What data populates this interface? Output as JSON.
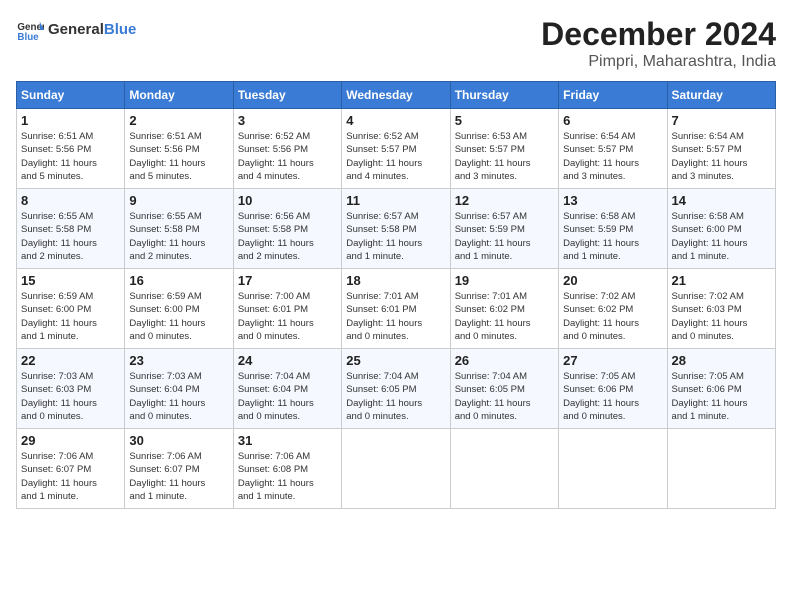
{
  "logo": {
    "general": "General",
    "blue": "Blue"
  },
  "title": "December 2024",
  "subtitle": "Pimpri, Maharashtra, India",
  "days_header": [
    "Sunday",
    "Monday",
    "Tuesday",
    "Wednesday",
    "Thursday",
    "Friday",
    "Saturday"
  ],
  "weeks": [
    [
      {
        "day": "1",
        "sunrise": "6:51 AM",
        "sunset": "5:56 PM",
        "daylight": "11 hours and 5 minutes."
      },
      {
        "day": "2",
        "sunrise": "6:51 AM",
        "sunset": "5:56 PM",
        "daylight": "11 hours and 5 minutes."
      },
      {
        "day": "3",
        "sunrise": "6:52 AM",
        "sunset": "5:56 PM",
        "daylight": "11 hours and 4 minutes."
      },
      {
        "day": "4",
        "sunrise": "6:52 AM",
        "sunset": "5:57 PM",
        "daylight": "11 hours and 4 minutes."
      },
      {
        "day": "5",
        "sunrise": "6:53 AM",
        "sunset": "5:57 PM",
        "daylight": "11 hours and 3 minutes."
      },
      {
        "day": "6",
        "sunrise": "6:54 AM",
        "sunset": "5:57 PM",
        "daylight": "11 hours and 3 minutes."
      },
      {
        "day": "7",
        "sunrise": "6:54 AM",
        "sunset": "5:57 PM",
        "daylight": "11 hours and 3 minutes."
      }
    ],
    [
      {
        "day": "8",
        "sunrise": "6:55 AM",
        "sunset": "5:58 PM",
        "daylight": "11 hours and 2 minutes."
      },
      {
        "day": "9",
        "sunrise": "6:55 AM",
        "sunset": "5:58 PM",
        "daylight": "11 hours and 2 minutes."
      },
      {
        "day": "10",
        "sunrise": "6:56 AM",
        "sunset": "5:58 PM",
        "daylight": "11 hours and 2 minutes."
      },
      {
        "day": "11",
        "sunrise": "6:57 AM",
        "sunset": "5:58 PM",
        "daylight": "11 hours and 1 minute."
      },
      {
        "day": "12",
        "sunrise": "6:57 AM",
        "sunset": "5:59 PM",
        "daylight": "11 hours and 1 minute."
      },
      {
        "day": "13",
        "sunrise": "6:58 AM",
        "sunset": "5:59 PM",
        "daylight": "11 hours and 1 minute."
      },
      {
        "day": "14",
        "sunrise": "6:58 AM",
        "sunset": "6:00 PM",
        "daylight": "11 hours and 1 minute."
      }
    ],
    [
      {
        "day": "15",
        "sunrise": "6:59 AM",
        "sunset": "6:00 PM",
        "daylight": "11 hours and 1 minute."
      },
      {
        "day": "16",
        "sunrise": "6:59 AM",
        "sunset": "6:00 PM",
        "daylight": "11 hours and 0 minutes."
      },
      {
        "day": "17",
        "sunrise": "7:00 AM",
        "sunset": "6:01 PM",
        "daylight": "11 hours and 0 minutes."
      },
      {
        "day": "18",
        "sunrise": "7:01 AM",
        "sunset": "6:01 PM",
        "daylight": "11 hours and 0 minutes."
      },
      {
        "day": "19",
        "sunrise": "7:01 AM",
        "sunset": "6:02 PM",
        "daylight": "11 hours and 0 minutes."
      },
      {
        "day": "20",
        "sunrise": "7:02 AM",
        "sunset": "6:02 PM",
        "daylight": "11 hours and 0 minutes."
      },
      {
        "day": "21",
        "sunrise": "7:02 AM",
        "sunset": "6:03 PM",
        "daylight": "11 hours and 0 minutes."
      }
    ],
    [
      {
        "day": "22",
        "sunrise": "7:03 AM",
        "sunset": "6:03 PM",
        "daylight": "11 hours and 0 minutes."
      },
      {
        "day": "23",
        "sunrise": "7:03 AM",
        "sunset": "6:04 PM",
        "daylight": "11 hours and 0 minutes."
      },
      {
        "day": "24",
        "sunrise": "7:04 AM",
        "sunset": "6:04 PM",
        "daylight": "11 hours and 0 minutes."
      },
      {
        "day": "25",
        "sunrise": "7:04 AM",
        "sunset": "6:05 PM",
        "daylight": "11 hours and 0 minutes."
      },
      {
        "day": "26",
        "sunrise": "7:04 AM",
        "sunset": "6:05 PM",
        "daylight": "11 hours and 0 minutes."
      },
      {
        "day": "27",
        "sunrise": "7:05 AM",
        "sunset": "6:06 PM",
        "daylight": "11 hours and 0 minutes."
      },
      {
        "day": "28",
        "sunrise": "7:05 AM",
        "sunset": "6:06 PM",
        "daylight": "11 hours and 1 minute."
      }
    ],
    [
      {
        "day": "29",
        "sunrise": "7:06 AM",
        "sunset": "6:07 PM",
        "daylight": "11 hours and 1 minute."
      },
      {
        "day": "30",
        "sunrise": "7:06 AM",
        "sunset": "6:07 PM",
        "daylight": "11 hours and 1 minute."
      },
      {
        "day": "31",
        "sunrise": "7:06 AM",
        "sunset": "6:08 PM",
        "daylight": "11 hours and 1 minute."
      },
      null,
      null,
      null,
      null
    ]
  ]
}
